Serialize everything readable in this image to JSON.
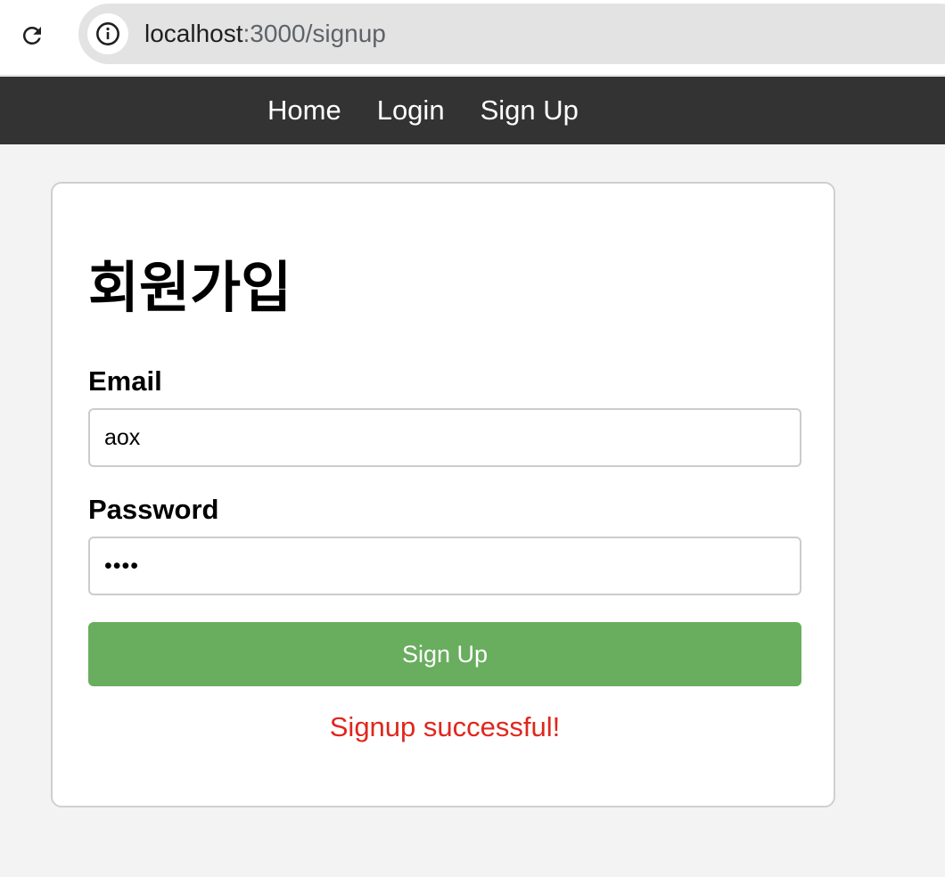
{
  "browser": {
    "url_host": "localhost",
    "url_path": ":3000/signup",
    "icons": {
      "reload": "reload-icon",
      "info": "info-icon"
    }
  },
  "nav": {
    "items": [
      {
        "label": "Home"
      },
      {
        "label": "Login"
      },
      {
        "label": "Sign Up"
      }
    ],
    "background": "#333333"
  },
  "form": {
    "title": "회원가입",
    "email_label": "Email",
    "email_value": "aox",
    "password_label": "Password",
    "password_value": "abcd",
    "submit_label": "Sign Up",
    "submit_color": "#69ad5e",
    "status_message": "Signup successful!",
    "status_color": "#e0261d"
  }
}
